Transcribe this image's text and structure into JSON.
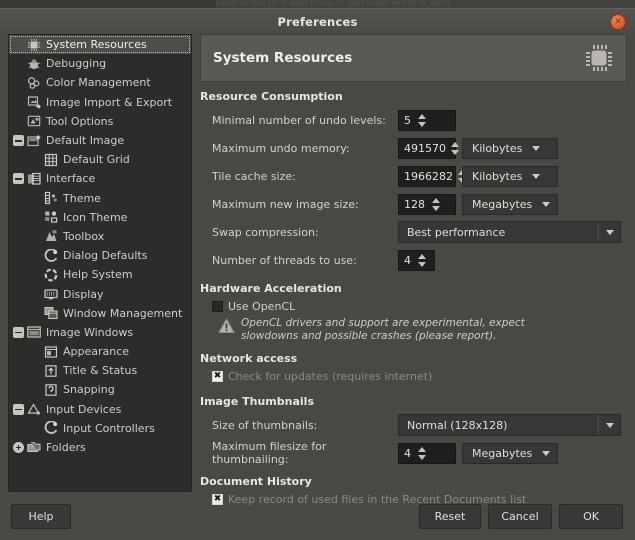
{
  "window": {
    "title": "Preferences",
    "close_icon": "close-icon",
    "behind_text": "ndrdit ihr tstsi rtlr tt Aedtl ntlihga tit diprt  ietadtl rhlit ttt ttt edriia"
  },
  "sidebar": {
    "items": [
      {
        "label": "System Resources",
        "icon": "cpu-chip-icon",
        "expander": "none",
        "indent": 0,
        "selected": true
      },
      {
        "label": "Debugging",
        "icon": "bug-icon",
        "expander": "none",
        "indent": 0,
        "selected": false
      },
      {
        "label": "Color Management",
        "icon": "color-wheel-icon",
        "expander": "none",
        "indent": 0,
        "selected": false
      },
      {
        "label": "Image Import & Export",
        "icon": "import-export-icon",
        "expander": "none",
        "indent": 0,
        "selected": false
      },
      {
        "label": "Tool Options",
        "icon": "tool-options-icon",
        "expander": "none",
        "indent": 0,
        "selected": false
      },
      {
        "label": "Default Image",
        "icon": "default-image-icon",
        "expander": "open",
        "indent": 0,
        "selected": false
      },
      {
        "label": "Default Grid",
        "icon": "grid-icon",
        "expander": "none",
        "indent": 1,
        "selected": false
      },
      {
        "label": "Interface",
        "icon": "interface-icon",
        "expander": "open",
        "indent": 0,
        "selected": false
      },
      {
        "label": "Theme",
        "icon": "theme-icon",
        "expander": "none",
        "indent": 1,
        "selected": false
      },
      {
        "label": "Icon Theme",
        "icon": "icon-theme-icon",
        "expander": "none",
        "indent": 1,
        "selected": false
      },
      {
        "label": "Toolbox",
        "icon": "toolbox-icon",
        "expander": "none",
        "indent": 1,
        "selected": false
      },
      {
        "label": "Dialog Defaults",
        "icon": "dialog-defaults-icon",
        "expander": "none",
        "indent": 1,
        "selected": false
      },
      {
        "label": "Help System",
        "icon": "help-system-icon",
        "expander": "none",
        "indent": 1,
        "selected": false
      },
      {
        "label": "Display",
        "icon": "display-icon",
        "expander": "none",
        "indent": 1,
        "selected": false
      },
      {
        "label": "Window Management",
        "icon": "window-management-icon",
        "expander": "none",
        "indent": 1,
        "selected": false
      },
      {
        "label": "Image Windows",
        "icon": "image-windows-icon",
        "expander": "open",
        "indent": 0,
        "selected": false
      },
      {
        "label": "Appearance",
        "icon": "appearance-icon",
        "expander": "none",
        "indent": 1,
        "selected": false
      },
      {
        "label": "Title & Status",
        "icon": "title-status-icon",
        "expander": "none",
        "indent": 1,
        "selected": false
      },
      {
        "label": "Snapping",
        "icon": "snapping-icon",
        "expander": "none",
        "indent": 1,
        "selected": false
      },
      {
        "label": "Input Devices",
        "icon": "input-devices-icon",
        "expander": "open",
        "indent": 0,
        "selected": false
      },
      {
        "label": "Input Controllers",
        "icon": "input-controllers-icon",
        "expander": "none",
        "indent": 1,
        "selected": false
      },
      {
        "label": "Folders",
        "icon": "folders-icon",
        "expander": "closed",
        "indent": 0,
        "selected": false
      }
    ]
  },
  "page": {
    "title": "System Resources",
    "icon": "cpu-chip-icon",
    "resource_consumption": {
      "title": "Resource Consumption",
      "min_undo_levels": {
        "label": "Minimal number of undo levels:",
        "value": "5"
      },
      "max_undo_memory": {
        "label": "Maximum undo memory:",
        "value": "491570",
        "unit": "Kilobytes"
      },
      "tile_cache_size": {
        "label": "Tile cache size:",
        "value": "1966282",
        "unit": "Kilobytes"
      },
      "max_new_image_size": {
        "label": "Maximum new image size:",
        "value": "128",
        "unit": "Megabytes"
      },
      "swap_compression": {
        "label": "Swap compression:",
        "value": "Best performance"
      },
      "num_threads": {
        "label": "Number of threads to use:",
        "value": "4"
      }
    },
    "hardware_acceleration": {
      "title": "Hardware Acceleration",
      "use_opencl": {
        "label": "Use OpenCL",
        "checked": false
      },
      "warning_icon": "warning-triangle-icon",
      "warning_text": "OpenCL drivers and support are experimental, expect slowdowns and possible crashes (please report)."
    },
    "network_access": {
      "title": "Network access",
      "check_updates": {
        "label": "Check for updates (requires internet)",
        "checked": true,
        "disabled": true,
        "mark": "✖"
      }
    },
    "image_thumbnails": {
      "title": "Image Thumbnails",
      "thumb_size": {
        "label": "Size of thumbnails:",
        "value": "Normal (128x128)"
      },
      "max_filesize": {
        "label": "Maximum filesize for thumbnailing:",
        "value": "4",
        "unit": "Megabytes"
      }
    },
    "document_history": {
      "title": "Document History",
      "keep_record": {
        "label": "Keep record of used files in the Recent Documents list",
        "checked": true,
        "disabled": true,
        "mark": "✖"
      }
    }
  },
  "buttons": {
    "help": "Help",
    "reset": "Reset",
    "cancel": "Cancel",
    "ok": "OK"
  }
}
